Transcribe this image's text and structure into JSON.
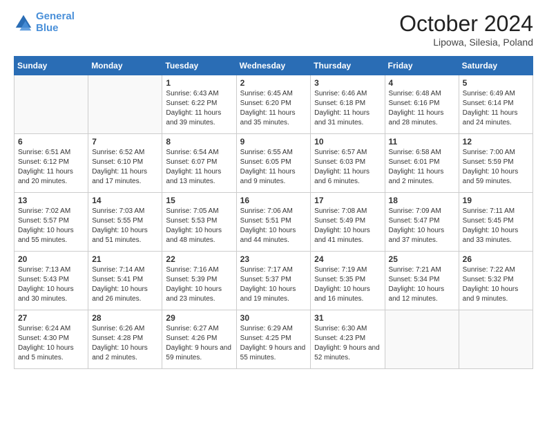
{
  "header": {
    "logo_line1": "General",
    "logo_line2": "Blue",
    "month_title": "October 2024",
    "location": "Lipowa, Silesia, Poland"
  },
  "days_of_week": [
    "Sunday",
    "Monday",
    "Tuesday",
    "Wednesday",
    "Thursday",
    "Friday",
    "Saturday"
  ],
  "weeks": [
    [
      {
        "day": "",
        "info": ""
      },
      {
        "day": "",
        "info": ""
      },
      {
        "day": "1",
        "info": "Sunrise: 6:43 AM\nSunset: 6:22 PM\nDaylight: 11 hours and 39 minutes."
      },
      {
        "day": "2",
        "info": "Sunrise: 6:45 AM\nSunset: 6:20 PM\nDaylight: 11 hours and 35 minutes."
      },
      {
        "day": "3",
        "info": "Sunrise: 6:46 AM\nSunset: 6:18 PM\nDaylight: 11 hours and 31 minutes."
      },
      {
        "day": "4",
        "info": "Sunrise: 6:48 AM\nSunset: 6:16 PM\nDaylight: 11 hours and 28 minutes."
      },
      {
        "day": "5",
        "info": "Sunrise: 6:49 AM\nSunset: 6:14 PM\nDaylight: 11 hours and 24 minutes."
      }
    ],
    [
      {
        "day": "6",
        "info": "Sunrise: 6:51 AM\nSunset: 6:12 PM\nDaylight: 11 hours and 20 minutes."
      },
      {
        "day": "7",
        "info": "Sunrise: 6:52 AM\nSunset: 6:10 PM\nDaylight: 11 hours and 17 minutes."
      },
      {
        "day": "8",
        "info": "Sunrise: 6:54 AM\nSunset: 6:07 PM\nDaylight: 11 hours and 13 minutes."
      },
      {
        "day": "9",
        "info": "Sunrise: 6:55 AM\nSunset: 6:05 PM\nDaylight: 11 hours and 9 minutes."
      },
      {
        "day": "10",
        "info": "Sunrise: 6:57 AM\nSunset: 6:03 PM\nDaylight: 11 hours and 6 minutes."
      },
      {
        "day": "11",
        "info": "Sunrise: 6:58 AM\nSunset: 6:01 PM\nDaylight: 11 hours and 2 minutes."
      },
      {
        "day": "12",
        "info": "Sunrise: 7:00 AM\nSunset: 5:59 PM\nDaylight: 10 hours and 59 minutes."
      }
    ],
    [
      {
        "day": "13",
        "info": "Sunrise: 7:02 AM\nSunset: 5:57 PM\nDaylight: 10 hours and 55 minutes."
      },
      {
        "day": "14",
        "info": "Sunrise: 7:03 AM\nSunset: 5:55 PM\nDaylight: 10 hours and 51 minutes."
      },
      {
        "day": "15",
        "info": "Sunrise: 7:05 AM\nSunset: 5:53 PM\nDaylight: 10 hours and 48 minutes."
      },
      {
        "day": "16",
        "info": "Sunrise: 7:06 AM\nSunset: 5:51 PM\nDaylight: 10 hours and 44 minutes."
      },
      {
        "day": "17",
        "info": "Sunrise: 7:08 AM\nSunset: 5:49 PM\nDaylight: 10 hours and 41 minutes."
      },
      {
        "day": "18",
        "info": "Sunrise: 7:09 AM\nSunset: 5:47 PM\nDaylight: 10 hours and 37 minutes."
      },
      {
        "day": "19",
        "info": "Sunrise: 7:11 AM\nSunset: 5:45 PM\nDaylight: 10 hours and 33 minutes."
      }
    ],
    [
      {
        "day": "20",
        "info": "Sunrise: 7:13 AM\nSunset: 5:43 PM\nDaylight: 10 hours and 30 minutes."
      },
      {
        "day": "21",
        "info": "Sunrise: 7:14 AM\nSunset: 5:41 PM\nDaylight: 10 hours and 26 minutes."
      },
      {
        "day": "22",
        "info": "Sunrise: 7:16 AM\nSunset: 5:39 PM\nDaylight: 10 hours and 23 minutes."
      },
      {
        "day": "23",
        "info": "Sunrise: 7:17 AM\nSunset: 5:37 PM\nDaylight: 10 hours and 19 minutes."
      },
      {
        "day": "24",
        "info": "Sunrise: 7:19 AM\nSunset: 5:35 PM\nDaylight: 10 hours and 16 minutes."
      },
      {
        "day": "25",
        "info": "Sunrise: 7:21 AM\nSunset: 5:34 PM\nDaylight: 10 hours and 12 minutes."
      },
      {
        "day": "26",
        "info": "Sunrise: 7:22 AM\nSunset: 5:32 PM\nDaylight: 10 hours and 9 minutes."
      }
    ],
    [
      {
        "day": "27",
        "info": "Sunrise: 6:24 AM\nSunset: 4:30 PM\nDaylight: 10 hours and 5 minutes."
      },
      {
        "day": "28",
        "info": "Sunrise: 6:26 AM\nSunset: 4:28 PM\nDaylight: 10 hours and 2 minutes."
      },
      {
        "day": "29",
        "info": "Sunrise: 6:27 AM\nSunset: 4:26 PM\nDaylight: 9 hours and 59 minutes."
      },
      {
        "day": "30",
        "info": "Sunrise: 6:29 AM\nSunset: 4:25 PM\nDaylight: 9 hours and 55 minutes."
      },
      {
        "day": "31",
        "info": "Sunrise: 6:30 AM\nSunset: 4:23 PM\nDaylight: 9 hours and 52 minutes."
      },
      {
        "day": "",
        "info": ""
      },
      {
        "day": "",
        "info": ""
      }
    ]
  ]
}
